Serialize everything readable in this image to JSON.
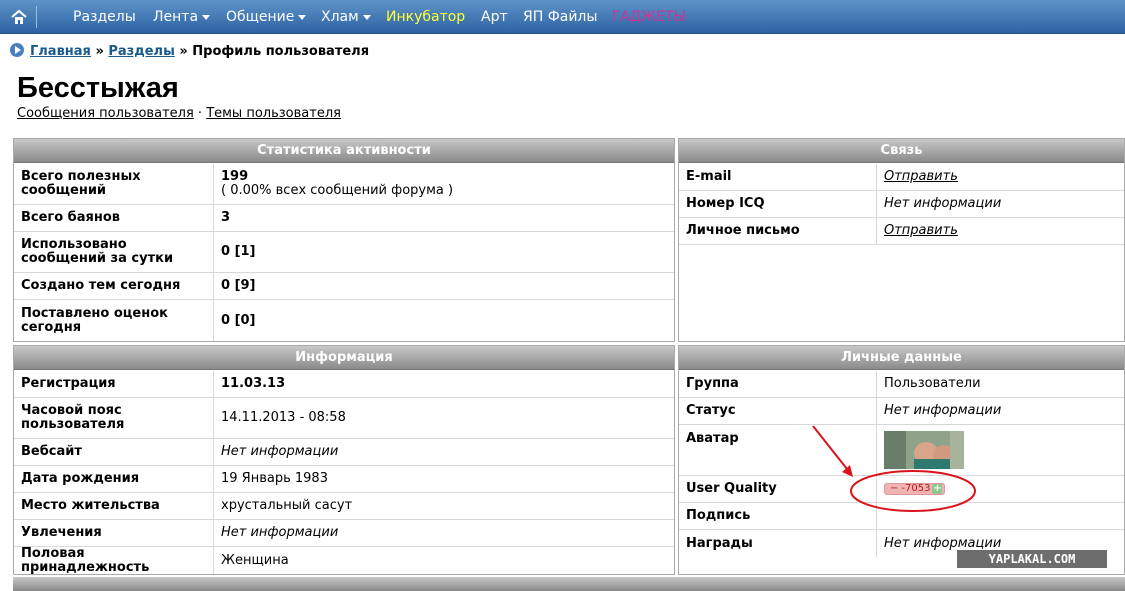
{
  "nav": {
    "items": [
      {
        "label": "Разделы",
        "color": "#ffffff",
        "dropdown": false
      },
      {
        "label": "Лента",
        "color": "#ffffff",
        "dropdown": true
      },
      {
        "label": "Общение",
        "color": "#ffffff",
        "dropdown": true
      },
      {
        "label": "Хлам",
        "color": "#ffffff",
        "dropdown": true
      },
      {
        "label": "Инкубатор",
        "color": "#ffff33",
        "dropdown": false
      },
      {
        "label": "Арт",
        "color": "#ffffff",
        "dropdown": false
      },
      {
        "label": "ЯП Файлы",
        "color": "#ffffff",
        "dropdown": false
      },
      {
        "label": "ГАДЖЕТЫ",
        "color": "#cc3399",
        "dropdown": false
      }
    ]
  },
  "breadcrumb": {
    "home": "Главная",
    "sections": "Разделы",
    "sep": "»",
    "current": "Профиль пользователя"
  },
  "profile": {
    "name": "Бесстыжая",
    "link_posts": "Сообщения пользователя",
    "dot": "·",
    "link_topics": "Темы пользователя"
  },
  "stats": {
    "title": "Статистика активности",
    "rows": [
      {
        "k": "Всего полезных сообщений",
        "v": "199",
        "v2": "( 0.00% всех сообщений форума )"
      },
      {
        "k": "Всего баянов",
        "v": "3"
      },
      {
        "k": "Использовано сообщений за сутки",
        "v": "0 [1]"
      },
      {
        "k": "Создано тем сегодня",
        "v": "0 [9]"
      },
      {
        "k": "Поставлено оценок сегодня",
        "v": "0 [0]"
      }
    ]
  },
  "contact": {
    "title": "Связь",
    "rows": [
      {
        "k": "E-mail",
        "v": "Отправить"
      },
      {
        "k": "Номер ICQ",
        "v": "Нет информации"
      },
      {
        "k": "Личное письмо",
        "v": "Отправить"
      }
    ]
  },
  "info": {
    "title": "Информация",
    "rows": [
      {
        "k": "Регистрация",
        "v": "11.03.13"
      },
      {
        "k": "Часовой пояс пользователя",
        "v": "14.11.2013 - 08:58"
      },
      {
        "k": "Вебсайт",
        "v": "Нет информации"
      },
      {
        "k": "Дата рождения",
        "v": "19 Январь 1983"
      },
      {
        "k": "Место жительства",
        "v": "хрустальный сасут"
      },
      {
        "k": "Увлечения",
        "v": "Нет информации"
      },
      {
        "k": "Половая принадлежность",
        "v": "Женщина"
      }
    ]
  },
  "personal": {
    "title": "Личные данные",
    "rows": [
      {
        "k": "Группа",
        "v": "Пользователи"
      },
      {
        "k": "Статус",
        "v": "Нет информации"
      },
      {
        "k": "Аватар",
        "v": ""
      },
      {
        "k": "User Quality",
        "v": "-7053",
        "minus": "−",
        "plus": "+"
      },
      {
        "k": "Подпись",
        "v": ""
      },
      {
        "k": "Награды",
        "v": "Нет информации"
      }
    ]
  },
  "watermark": "YAPLAKAL.COM",
  "colors": {
    "accent": "#2d63a2",
    "annotation": "#d9141b"
  }
}
